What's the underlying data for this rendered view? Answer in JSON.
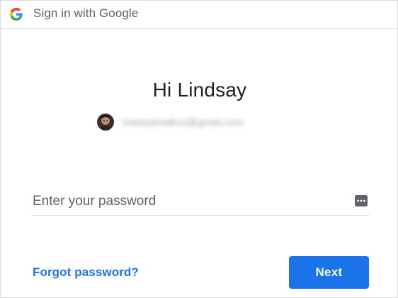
{
  "header": {
    "logo_icon": "google-g-icon",
    "title": "Sign in with Google"
  },
  "greeting": "Hi Lindsay",
  "account": {
    "avatar_icon": "avatar-photo",
    "email": "lindsayhodkos@gmail.com"
  },
  "password": {
    "placeholder": "Enter your password",
    "value": "",
    "icon": "password-dots-icon"
  },
  "actions": {
    "forgot_label": "Forgot password?",
    "next_label": "Next"
  },
  "colors": {
    "accent": "#1a73e8",
    "divider": "#dadce0",
    "text_primary": "#202124",
    "text_secondary": "#5f6368"
  }
}
